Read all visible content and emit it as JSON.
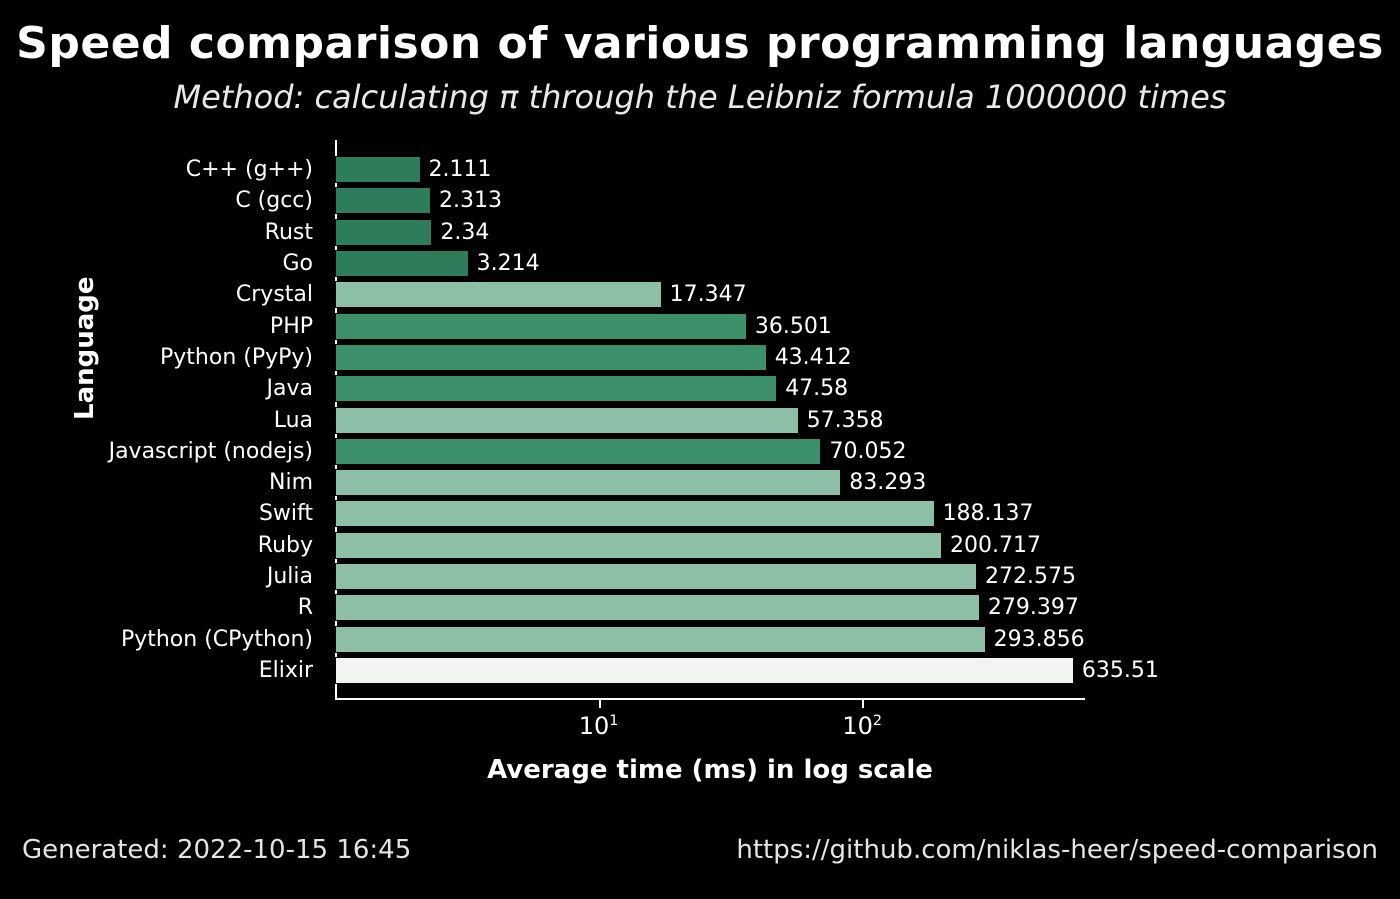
{
  "chart_data": {
    "type": "bar",
    "title": "Speed comparison of various programming languages",
    "subtitle": "Method: calculating π through the Leibniz formula 1000000 times",
    "xlabel": "Average time (ms) in log scale",
    "ylabel": "Language",
    "x_scale": "log10",
    "xlim": [
      1,
      700
    ],
    "xticks": [
      10,
      100
    ],
    "categories": [
      "C++ (g++)",
      "C (gcc)",
      "Rust",
      "Go",
      "Crystal",
      "PHP",
      "Python (PyPy)",
      "Java",
      "Lua",
      "Javascript (nodejs)",
      "Nim",
      "Swift",
      "Ruby",
      "Julia",
      "R",
      "Python (CPython)",
      "Elixir"
    ],
    "values": [
      2.111,
      2.313,
      2.34,
      3.214,
      17.347,
      36.501,
      43.412,
      47.58,
      57.358,
      70.052,
      83.293,
      188.137,
      200.717,
      272.575,
      279.397,
      293.856,
      635.51
    ],
    "bar_color_class": [
      "c0",
      "c0",
      "c0",
      "c0",
      "c2",
      "c1",
      "c1",
      "c1",
      "c2",
      "c1",
      "c2",
      "c2",
      "c2",
      "c2",
      "c2",
      "c2",
      "c3"
    ]
  },
  "footer": {
    "generated_label": "Generated: 2022-10-15 16:45",
    "source_url": "https://github.com/niklas-heer/speed-comparison"
  }
}
